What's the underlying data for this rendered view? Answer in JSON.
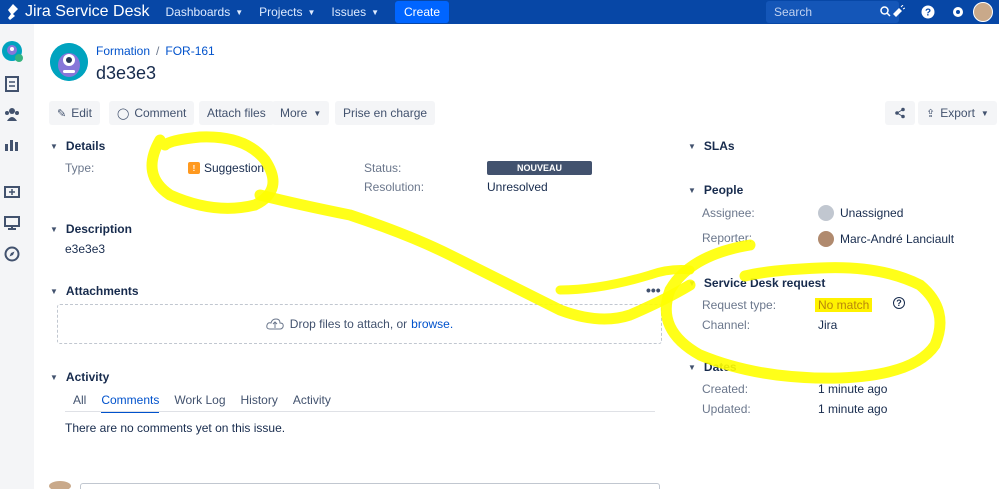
{
  "app": {
    "name": "Jira Service Desk",
    "nav": [
      {
        "label": "Dashboards"
      },
      {
        "label": "Projects"
      },
      {
        "label": "Issues"
      }
    ],
    "create_label": "Create",
    "search_placeholder": "Search"
  },
  "issue": {
    "project": "Formation",
    "key": "FOR-161",
    "title": "d3e3e3"
  },
  "toolbar": {
    "edit": "Edit",
    "comment": "Comment",
    "attach": "Attach files",
    "more": "More",
    "prise": "Prise en charge",
    "export": "Export"
  },
  "details": {
    "heading": "Details",
    "type_label": "Type:",
    "type_value": "Suggestion",
    "status_label": "Status:",
    "status_value": "NOUVEAU",
    "resolution_label": "Resolution:",
    "resolution_value": "Unresolved"
  },
  "description": {
    "heading": "Description",
    "text": "e3e3e3"
  },
  "attachments": {
    "heading": "Attachments",
    "drop_text": "Drop files to attach, or",
    "browse": "browse."
  },
  "activity": {
    "heading": "Activity",
    "tabs": [
      "All",
      "Comments",
      "Work Log",
      "History",
      "Activity"
    ],
    "active_tab": "Comments",
    "empty": "There are no comments yet on this issue."
  },
  "side": {
    "slas": "SLAs",
    "people": {
      "heading": "People",
      "assignee_label": "Assignee:",
      "assignee": "Unassigned",
      "reporter_label": "Reporter:",
      "reporter": "Marc-André Lanciault"
    },
    "sd": {
      "heading": "Service Desk request",
      "request_type_label": "Request type:",
      "request_type": "No match",
      "channel_label": "Channel:",
      "channel": "Jira"
    },
    "dates": {
      "heading": "Dates",
      "created_label": "Created:",
      "created": "1 minute ago",
      "updated_label": "Updated:",
      "updated": "1 minute ago"
    }
  },
  "colors": {
    "topbar": "#0747a6",
    "annotation": "#ffff00",
    "status": "#42526e"
  }
}
